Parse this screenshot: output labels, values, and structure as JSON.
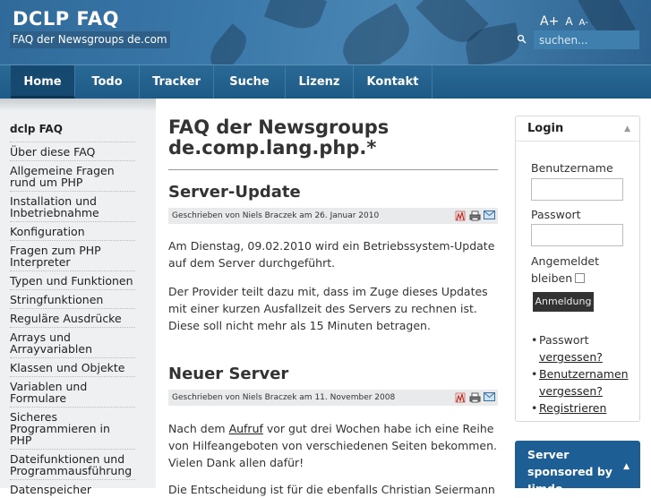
{
  "header": {
    "site_title": "DCLP FAQ",
    "site_subtitle": "FAQ der Newsgroups de.com",
    "font_size_controls": [
      "A+",
      "A",
      "A-"
    ],
    "search_placeholder": "suchen...",
    "search_icon": "search-icon"
  },
  "nav": {
    "items": [
      {
        "label": "Home",
        "active": true
      },
      {
        "label": "Todo"
      },
      {
        "label": "Tracker"
      },
      {
        "label": "Suche"
      },
      {
        "label": "Lizenz"
      },
      {
        "label": "Kontakt"
      }
    ]
  },
  "sidebar": {
    "title": "dclp FAQ",
    "items": [
      "Über diese FAQ",
      "Allgemeine Fragen rund um PHP",
      "Installation und Inbetriebnahme",
      "Konfiguration",
      "Fragen zum PHP Interpreter",
      "Typen und Funktionen",
      "Stringfunktionen",
      "Reguläre Ausdrücke",
      "Arrays und Arrayvariablen",
      "Klassen und Objekte",
      "Variablen und Formulare",
      "Sicheres Programmieren in PHP",
      "Dateifunktionen und Programmausführung",
      "Datenspeicher"
    ]
  },
  "main": {
    "title": "FAQ der Newsgroups de.comp.lang.php.*",
    "posts": [
      {
        "title": "Server-Update",
        "meta": "Geschrieben von Niels Braczek am 26. Januar 2010",
        "paragraphs": [
          "Am Dienstag, 09.02.2010 wird ein Betriebssystem-Update auf dem Server durchgeführt.",
          "Der Provider teilt dazu mit, dass im Zuge dieses Updates mit einer kurzen Ausfallzeit des Servers zu rechnen ist. Diese soll nicht mehr als 15 Minuten betragen."
        ]
      },
      {
        "title": "Neuer Server",
        "meta": "Geschrieben von Niels Braczek am 11. November 2008",
        "paragraph_before_link": "Nach dem ",
        "link": "Aufruf",
        "paragraph_after_link": " vor gut drei Wochen habe ich eine Reihe von Hilfeangeboten von verschiedenen Seiten bekommen. Vielen Dank allen dafür!",
        "cut_paragraph": "Die Entscheidung ist für die ebenfalls Christian Seiermann"
      }
    ],
    "icons": [
      "pdf-icon",
      "print-icon",
      "email-icon"
    ]
  },
  "login": {
    "title": "Login",
    "username_label": "Benutzername",
    "password_label": "Passwort",
    "remember_label_1": "Angemeldet",
    "remember_label_2": "bleiben",
    "button": "Anmeldung",
    "links": [
      {
        "text": "Passwort",
        "link": "vergessen?"
      },
      {
        "link": "Benutzernamen vergessen?"
      },
      {
        "link": "Registrieren"
      }
    ]
  },
  "sponsor": {
    "text": "Server sponsored by Jimdo"
  },
  "colors": {
    "header_blue": "#3b79aa",
    "nav_blue": "#2a6996",
    "nav_active": "#16496f",
    "sponsor_blue": "#1d5f94"
  }
}
